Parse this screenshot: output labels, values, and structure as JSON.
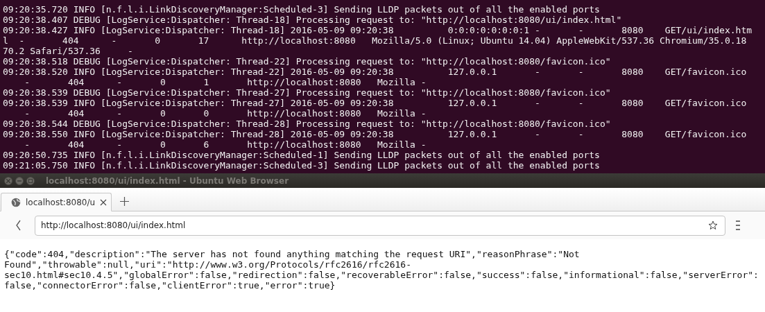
{
  "terminal": {
    "lines": [
      "09:20:35.720 INFO [n.f.l.i.LinkDiscoveryManager:Scheduled-3] Sending LLDP packets out of all the enabled ports",
      "09:20:38.407 DEBUG [LogService:Dispatcher: Thread-18] Processing request to: \"http://localhost:8080/ui/index.html\"",
      "09:20:38.427 INFO [LogService:Dispatcher: Thread-18] 2016-05-09 09:20:38          0:0:0:0:0:0:0:1 -       -       8080    GET/ui/index.htm",
      "l  -       404      -       0       17      http://localhost:8080   Mozilla/5.0 (Linux; Ubuntu 14.04) AppleWebKit/537.36 Chromium/35.0.18",
      "70.2 Safari/537.36     -",
      "09:20:38.518 DEBUG [LogService:Dispatcher: Thread-22] Processing request to: \"http://localhost:8080/favicon.ico\"",
      "09:20:38.520 INFO [LogService:Dispatcher: Thread-22] 2016-05-09 09:20:38          127.0.0.1       -       -       8080    GET/favicon.ico",
      "    -       404      -       0       1       http://localhost:8080   Mozilla -",
      "09:20:38.539 DEBUG [LogService:Dispatcher: Thread-27] Processing request to: \"http://localhost:8080/favicon.ico\"",
      "09:20:38.539 INFO [LogService:Dispatcher: Thread-27] 2016-05-09 09:20:38          127.0.0.1       -       -       8080    GET/favicon.ico",
      "    -       404      -       0       0       http://localhost:8080   Mozilla -",
      "09:20:38.544 DEBUG [LogService:Dispatcher: Thread-28] Processing request to: \"http://localhost:8080/favicon.ico\"",
      "09:20:38.550 INFO [LogService:Dispatcher: Thread-28] 2016-05-09 09:20:38          127.0.0.1       -       -       8080    GET/favicon.ico",
      "    -       404      -       0       6       http://localhost:8080   Mozilla -",
      "09:20:50.735 INFO [n.f.l.i.LinkDiscoveryManager:Scheduled-1] Sending LLDP packets out of all the enabled ports",
      "09:21:05.750 INFO [n.f.l.i.LinkDiscoveryManager:Scheduled-3] Sending LLDP packets out of all the enabled ports"
    ]
  },
  "browser": {
    "window": {
      "title": "localhost:8080/ui/index.html - Ubuntu Web Browser"
    },
    "tabs": [
      {
        "label": "localhost:8080/u",
        "selected": true
      }
    ],
    "address_bar": {
      "value": "http://localhost:8080/ui/index.html"
    },
    "page": {
      "lines": [
        "{\"code\":404,\"description\":\"The server has not found anything matching the request URI\",\"reasonPhrase\":\"Not",
        "Found\",\"throwable\":null,\"uri\":\"http://www.w3.org/Protocols/rfc2616/rfc2616-",
        "sec10.html#sec10.4.5\",\"globalError\":false,\"redirection\":false,\"recoverableError\":false,\"success\":false,\"informational\":false,\"serverError\":",
        "false,\"connectorError\":false,\"clientError\":true,\"error\":true}"
      ]
    }
  }
}
